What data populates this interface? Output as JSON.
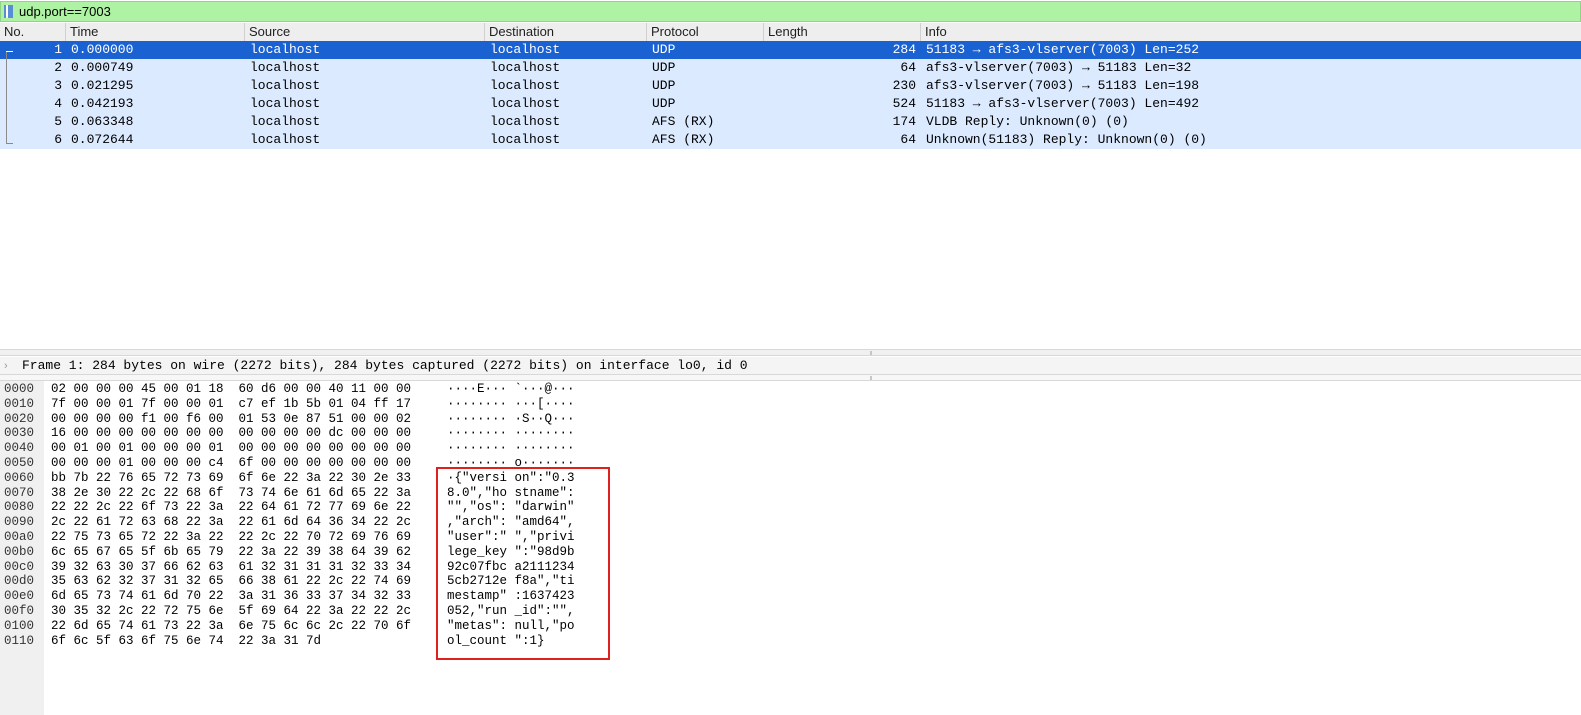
{
  "filter": {
    "value": "udp.port==7003",
    "icon": "bookmark-icon"
  },
  "packet_list": {
    "columns": [
      "No.",
      "Time",
      "Source",
      "Destination",
      "Protocol",
      "Length",
      "Info"
    ],
    "rows": [
      {
        "no": "1",
        "time": "0.000000",
        "source": "localhost",
        "destination": "localhost",
        "protocol": "UDP",
        "length": "284",
        "info": "51183 → afs3-vlserver(7003) Len=252",
        "selected": true
      },
      {
        "no": "2",
        "time": "0.000749",
        "source": "localhost",
        "destination": "localhost",
        "protocol": "UDP",
        "length": "64",
        "info": "afs3-vlserver(7003) → 51183 Len=32"
      },
      {
        "no": "3",
        "time": "0.021295",
        "source": "localhost",
        "destination": "localhost",
        "protocol": "UDP",
        "length": "230",
        "info": "afs3-vlserver(7003) → 51183 Len=198"
      },
      {
        "no": "4",
        "time": "0.042193",
        "source": "localhost",
        "destination": "localhost",
        "protocol": "UDP",
        "length": "524",
        "info": "51183 → afs3-vlserver(7003) Len=492"
      },
      {
        "no": "5",
        "time": "0.063348",
        "source": "localhost",
        "destination": "localhost",
        "protocol": "AFS (RX)",
        "length": "174",
        "info": "VLDB Reply: Unknown(0) (0)"
      },
      {
        "no": "6",
        "time": "0.072644",
        "source": "localhost",
        "destination": "localhost",
        "protocol": "AFS (RX)",
        "length": "64",
        "info": "Unknown(51183) Reply: Unknown(0) (0)"
      }
    ]
  },
  "details": {
    "arrow": "›",
    "frame_summary": "Frame 1: 284 bytes on wire (2272 bits), 284 bytes captured (2272 bits) on interface lo0, id 0"
  },
  "bytes": [
    {
      "offset": "0000",
      "hex": "02 00 00 00 45 00 01 18  60 d6 00 00 40 11 00 00",
      "ascii": "····E··· `···@···"
    },
    {
      "offset": "0010",
      "hex": "7f 00 00 01 7f 00 00 01  c7 ef 1b 5b 01 04 ff 17",
      "ascii": "········ ···[····"
    },
    {
      "offset": "0020",
      "hex": "00 00 00 00 f1 00 f6 00  01 53 0e 87 51 00 00 02",
      "ascii": "········ ·S··Q···"
    },
    {
      "offset": "0030",
      "hex": "16 00 00 00 00 00 00 00  00 00 00 00 dc 00 00 00",
      "ascii": "········ ········"
    },
    {
      "offset": "0040",
      "hex": "00 01 00 01 00 00 00 01  00 00 00 00 00 00 00 00",
      "ascii": "········ ········"
    },
    {
      "offset": "0050",
      "hex": "00 00 00 01 00 00 00 c4  6f 00 00 00 00 00 00 00",
      "ascii": "········ o·······"
    },
    {
      "offset": "0060",
      "hex": "bb 7b 22 76 65 72 73 69  6f 6e 22 3a 22 30 2e 33",
      "ascii": "·{\"versi on\":\"0.3"
    },
    {
      "offset": "0070",
      "hex": "38 2e 30 22 2c 22 68 6f  73 74 6e 61 6d 65 22 3a",
      "ascii": "8.0\",\"ho stname\":"
    },
    {
      "offset": "0080",
      "hex": "22 22 2c 22 6f 73 22 3a  22 64 61 72 77 69 6e 22",
      "ascii": "\"\",\"os\": \"darwin\""
    },
    {
      "offset": "0090",
      "hex": "2c 22 61 72 63 68 22 3a  22 61 6d 64 36 34 22 2c",
      "ascii": ",\"arch\": \"amd64\","
    },
    {
      "offset": "00a0",
      "hex": "22 75 73 65 72 22 3a 22  22 2c 22 70 72 69 76 69",
      "ascii": "\"user\":\" \",\"privi"
    },
    {
      "offset": "00b0",
      "hex": "6c 65 67 65 5f 6b 65 79  22 3a 22 39 38 64 39 62",
      "ascii": "lege_key \":\"98d9b"
    },
    {
      "offset": "00c0",
      "hex": "39 32 63 30 37 66 62 63  61 32 31 31 31 32 33 34",
      "ascii": "92c07fbc a2111234"
    },
    {
      "offset": "00d0",
      "hex": "35 63 62 32 37 31 32 65  66 38 61 22 2c 22 74 69",
      "ascii": "5cb2712e f8a\",\"ti"
    },
    {
      "offset": "00e0",
      "hex": "6d 65 73 74 61 6d 70 22  3a 31 36 33 37 34 32 33",
      "ascii": "mestamp\" :1637423"
    },
    {
      "offset": "00f0",
      "hex": "30 35 32 2c 22 72 75 6e  5f 69 64 22 3a 22 22 2c",
      "ascii": "052,\"run _id\":\"\","
    },
    {
      "offset": "0100",
      "hex": "22 6d 65 74 61 73 22 3a  6e 75 6c 6c 2c 22 70 6f",
      "ascii": "\"metas\": null,\"po"
    },
    {
      "offset": "0110",
      "hex": "6f 6c 5f 63 6f 75 6e 74  22 3a 31 7d",
      "ascii": "ol_count \":1}"
    }
  ],
  "colors": {
    "filter_bg": "#aef3a4",
    "selected_row": "#1a62d2",
    "row_bg": "#dbeaff",
    "highlight_border": "#e0201e"
  }
}
